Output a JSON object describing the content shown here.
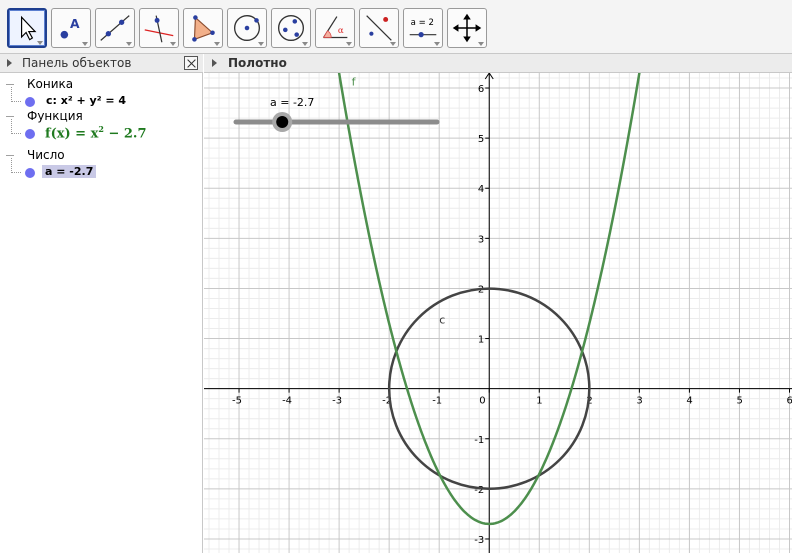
{
  "toolbar": {
    "tools": [
      {
        "name": "move-tool",
        "icon": "cursor-arrow-icon",
        "active": true
      },
      {
        "name": "point-tool",
        "icon": "point-icon",
        "active": false
      },
      {
        "name": "line-tool",
        "icon": "line-through-points-icon",
        "active": false
      },
      {
        "name": "perpendicular-tool",
        "icon": "perpendicular-line-icon",
        "active": false
      },
      {
        "name": "polygon-tool",
        "icon": "polygon-icon",
        "active": false
      },
      {
        "name": "circle-tool",
        "icon": "circle-center-point-icon",
        "active": false
      },
      {
        "name": "conic-tool",
        "icon": "ellipse-icon",
        "active": false
      },
      {
        "name": "angle-tool",
        "icon": "angle-icon",
        "active": false
      },
      {
        "name": "reflect-tool",
        "icon": "reflect-icon",
        "active": false
      },
      {
        "name": "slider-tool",
        "icon": "slider-icon",
        "label": "a = 2",
        "active": false
      },
      {
        "name": "move-view-tool",
        "icon": "move-graphics-icon",
        "active": false
      }
    ]
  },
  "algebra": {
    "title": "Панель объектов",
    "categories": [
      {
        "label": "Коника",
        "items": [
          {
            "value": "c: x² + y² = 4"
          }
        ]
      },
      {
        "label": "Функция",
        "items": [
          {
            "value_parts": [
              "f(x) = x",
              "2",
              " − 2.7"
            ]
          }
        ]
      },
      {
        "label": "Число",
        "items": [
          {
            "value": "a = -2.7",
            "selected": true
          }
        ]
      }
    ],
    "colors": {
      "dot": "#6e6ef0",
      "function": "#1f7a1f",
      "selection": "#c9c9e6"
    }
  },
  "graphics": {
    "title": "Полотно",
    "labels": {
      "function": "f",
      "circle": "c"
    },
    "slider": {
      "label": "a = -2.7",
      "value": -2.7,
      "min": -5,
      "max": 5
    },
    "functions": [
      {
        "name": "f",
        "expression": "x^2 - 2.7",
        "color": "#4d8f4d"
      }
    ],
    "circles": [
      {
        "name": "c",
        "center": [
          0,
          0
        ],
        "radius": 2,
        "color": "#444444"
      }
    ],
    "x_ticks": [
      -5,
      -4,
      -3,
      -2,
      -1,
      0,
      1,
      2,
      3,
      4,
      5,
      6
    ],
    "y_ticks": [
      -3,
      -2,
      -1,
      1,
      2,
      3,
      4,
      5,
      6
    ],
    "view": {
      "xmin": -5.7,
      "xmax": 6.05,
      "ymin": -3.28,
      "ymax": 6.3
    }
  }
}
